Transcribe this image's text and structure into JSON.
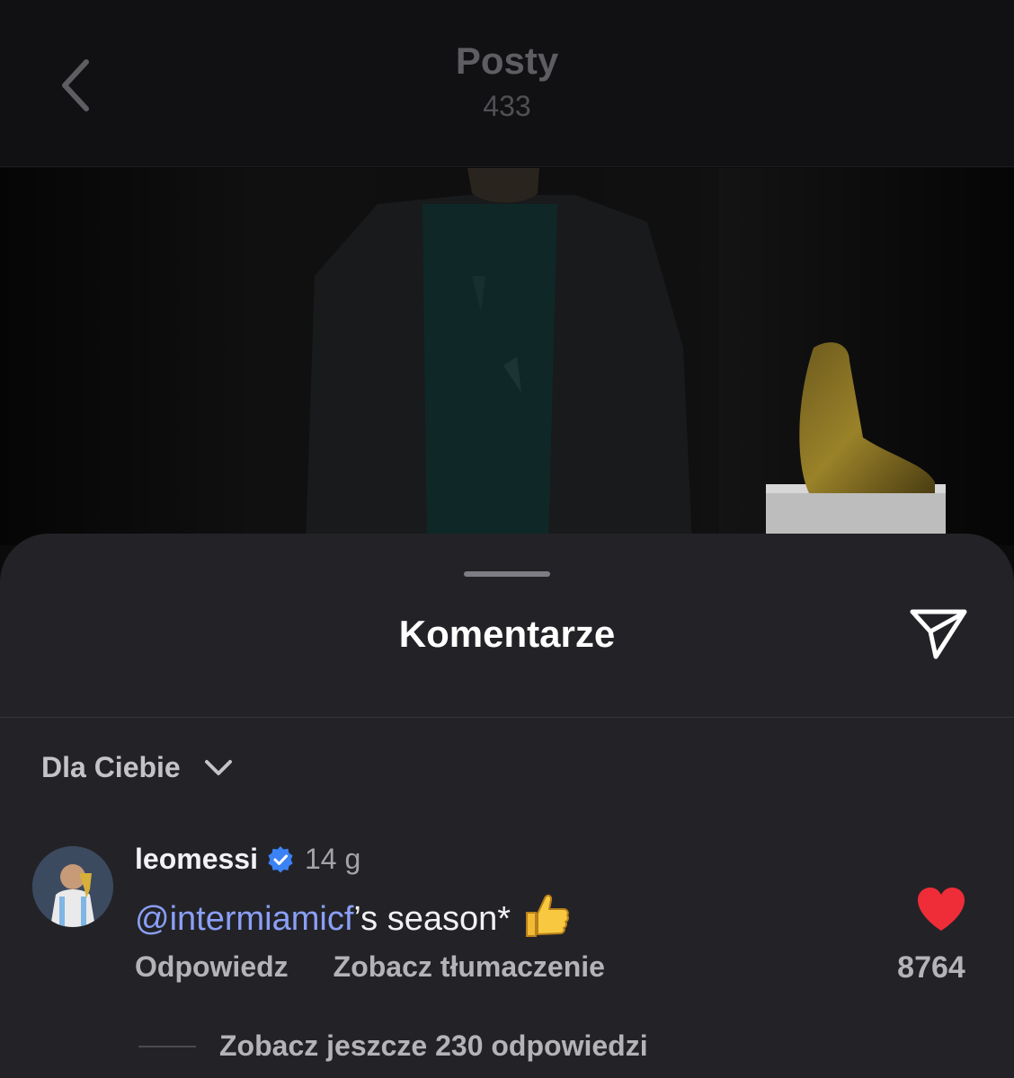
{
  "header": {
    "title": "Posty",
    "count": "433"
  },
  "sheet": {
    "title": "Komentarze"
  },
  "sort": {
    "label": "Dla Ciebie"
  },
  "comment": {
    "username": "leomessi",
    "verified": true,
    "time": "14 g",
    "mention": "@intermiamicf",
    "text": "’s season*",
    "emoji": "👍",
    "reply_label": "Odpowiedz",
    "translate_label": "Zobacz tłumaczenie",
    "likes": "8764",
    "liked": true,
    "more_replies": "Zobacz jeszcze 230 odpowiedzi"
  },
  "colors": {
    "sheet_bg": "#232327",
    "mention": "#8a9ff7",
    "like_red": "#ef2d38",
    "verified_blue": "#3b82f6"
  }
}
